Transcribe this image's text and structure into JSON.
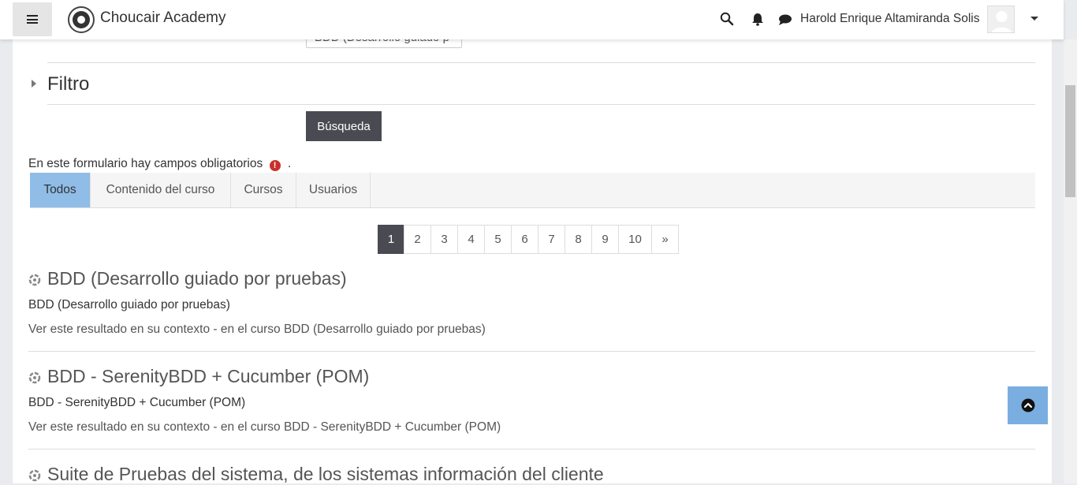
{
  "header": {
    "brand": "Choucair Academy",
    "user_name": "Harold Enrique Altamiranda Solis"
  },
  "form": {
    "partial_select_value": "BDD (Desarrollo guiado p",
    "filter_title": "Filtro",
    "search_button": "Búsqueda",
    "required_note": "En este formulario hay campos obligatorios",
    "required_suffix": "."
  },
  "tabs": [
    "Todos",
    "Contenido del curso",
    "Cursos",
    "Usuarios"
  ],
  "active_tab": "Todos",
  "pagination": [
    "1",
    "2",
    "3",
    "4",
    "5",
    "6",
    "7",
    "8",
    "9",
    "10",
    "»"
  ],
  "current_page": "1",
  "results": [
    {
      "title": "BDD (Desarrollo guiado por pruebas)",
      "subtitle": "BDD (Desarrollo guiado por pruebas)",
      "context": "Ver este resultado en su contexto - en el curso BDD (Desarrollo guiado por pruebas)"
    },
    {
      "title": "BDD - SerenityBDD + Cucumber (POM)",
      "subtitle": "BDD - SerenityBDD + Cucumber (POM)",
      "context": "Ver este resultado en su contexto - en el curso BDD - SerenityBDD + Cucumber (POM)"
    },
    {
      "title": "Suite de Pruebas del sistema, de los sistemas información del cliente"
    }
  ],
  "colors": {
    "active_tab": "#8fbde7",
    "button_dark": "#4a4a52",
    "back_to_top": "#7aaee0",
    "required": "#c9302c"
  }
}
